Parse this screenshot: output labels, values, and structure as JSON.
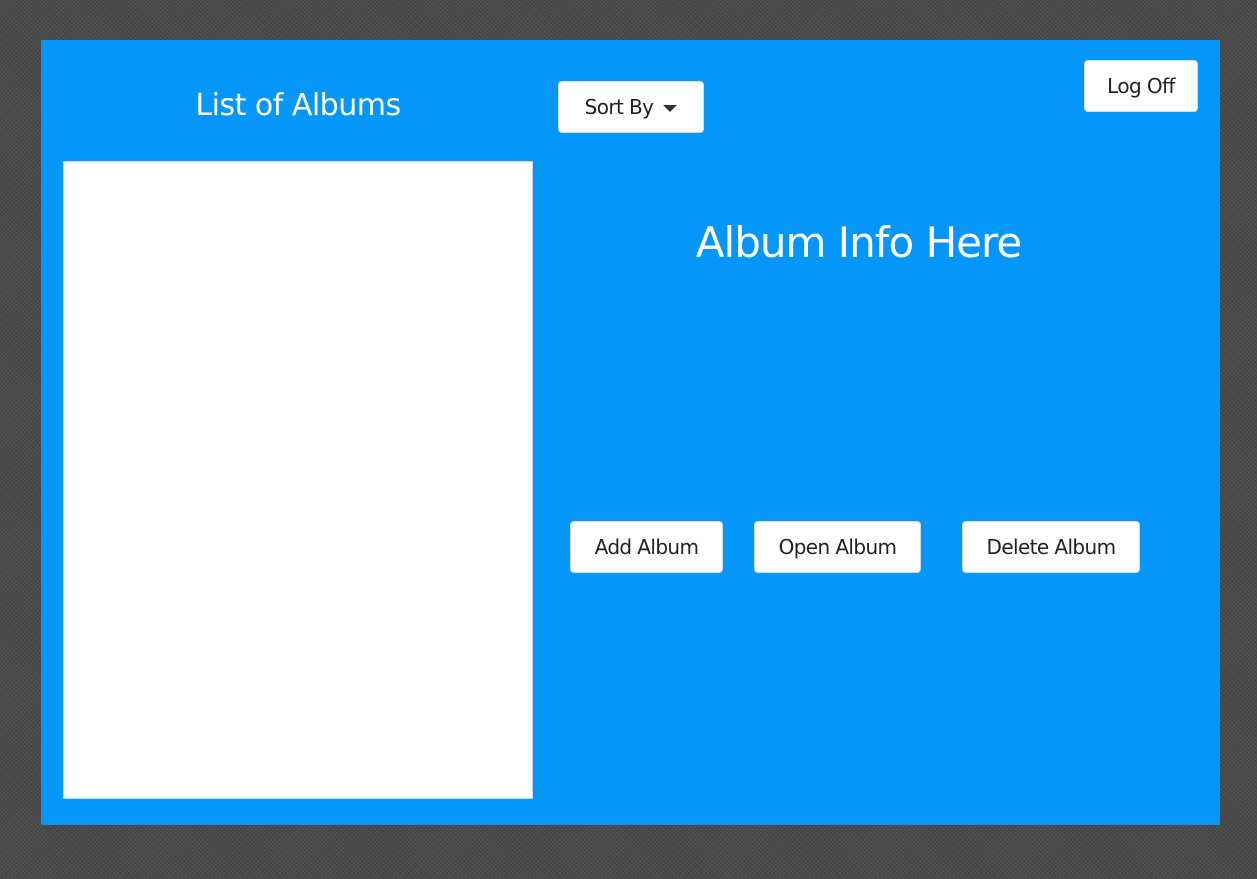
{
  "window": {
    "background_color": "#0596fa"
  },
  "album_list": {
    "title": "List of Albums",
    "items": []
  },
  "toolbar": {
    "sort_label": "Sort By",
    "logoff_label": "Log Off"
  },
  "album_info": {
    "title": "Album Info Here"
  },
  "actions": {
    "add_label": "Add Album",
    "open_label": "Open Album",
    "delete_label": "Delete Album"
  },
  "icons": {
    "sort_caret": "chevron-down-icon"
  }
}
